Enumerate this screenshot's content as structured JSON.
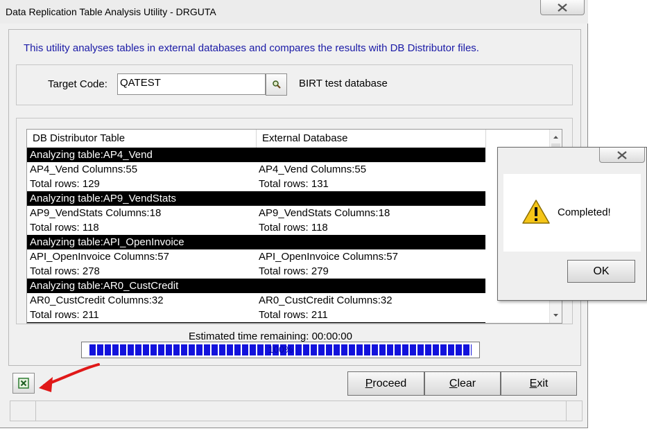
{
  "window": {
    "title": "Data Replication Table Analysis Utility - DRGUTA",
    "intro": "This utility analyses tables in external databases and compares the results with DB Distributor files."
  },
  "target": {
    "label": "Target Code:",
    "value": "QATEST",
    "description": "BIRT test database"
  },
  "table": {
    "columns": [
      "DB Distributor Table",
      "External Database"
    ],
    "blocks": [
      {
        "header": "Analyzing table:AP4_Vend",
        "rows": [
          [
            "AP4_Vend Columns:55",
            "AP4_Vend Columns:55"
          ],
          [
            "Total rows: 129",
            "Total rows: 131"
          ]
        ]
      },
      {
        "header": "Analyzing table:AP9_VendStats",
        "rows": [
          [
            "AP9_VendStats Columns:18",
            "AP9_VendStats Columns:18"
          ],
          [
            "Total rows: 118",
            "Total rows: 118"
          ]
        ]
      },
      {
        "header": "Analyzing table:API_OpenInvoice",
        "rows": [
          [
            "API_OpenInvoice Columns:57",
            "API_OpenInvoice Columns:57"
          ],
          [
            "Total rows: 278",
            "Total rows: 279"
          ]
        ]
      },
      {
        "header": "Analyzing table:AR0_CustCredit",
        "rows": [
          [
            "AR0_CustCredit Columns:32",
            "AR0_CustCredit Columns:32"
          ],
          [
            "Total rows: 211",
            "Total rows: 211"
          ]
        ]
      }
    ]
  },
  "progress": {
    "estimate": "Estimated time remaining: 00:00:00",
    "label": "100%",
    "fraction": 1.0
  },
  "buttons": {
    "proceed_first": "P",
    "proceed_rest": "roceed",
    "clear_first": "C",
    "clear_rest": "lear",
    "exit_first": "E",
    "exit_rest": "xit"
  },
  "dialog": {
    "message": "Completed!",
    "ok_label": "OK"
  },
  "colors": {
    "accent_text": "#1a1aa6",
    "progress_fill": "#1212dc",
    "annotation_arrow": "#e01818"
  },
  "icons": {
    "lookup": "magnifier-icon",
    "export": "excel-icon",
    "warning": "warning-triangle-icon",
    "close": "close-icon"
  }
}
